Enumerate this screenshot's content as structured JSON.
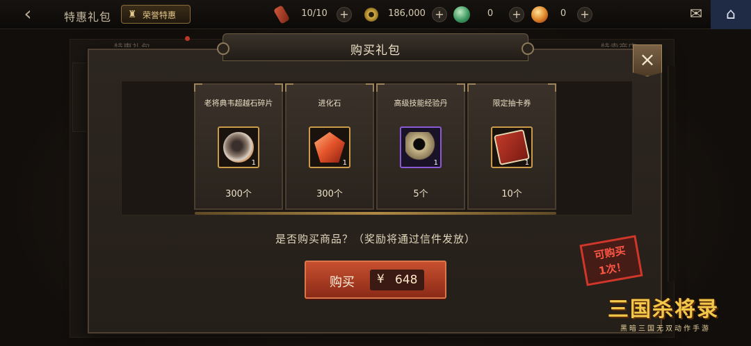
{
  "topbar": {
    "back_icon": "chevron-left-icon",
    "title": "特惠礼包",
    "honor_badge": "荣誉特惠",
    "resources": [
      {
        "name": "scroll",
        "value": "10/10",
        "color": "#b33a2a"
      },
      {
        "name": "copper-coin",
        "value": "186,000",
        "color": "#c9a34a"
      },
      {
        "name": "jade-orb",
        "value": "0",
        "color": "#3e9a62"
      },
      {
        "name": "gold-ingot",
        "value": "0",
        "color": "#d4782c"
      }
    ],
    "plus_glyph": "+",
    "chat_icon": "chat-bubble-icon",
    "home_icon": "home-icon"
  },
  "background": {
    "tab_left": "特惠礼包",
    "tab_right": "特卖商店"
  },
  "dialog": {
    "title": "购买礼包",
    "close_glyph": "×",
    "items": [
      {
        "name": "老将典韦超越石碎片",
        "qty": "300个",
        "count": "1",
        "icon": "dianwei-stone-fragment-icon",
        "rarity": "gold"
      },
      {
        "name": "进化石",
        "qty": "300个",
        "count": "1",
        "icon": "evolution-stone-icon",
        "rarity": "gold"
      },
      {
        "name": "高级技能经验丹",
        "qty": "5个",
        "count": "1",
        "icon": "skill-exp-pill-icon",
        "rarity": "purple"
      },
      {
        "name": "限定抽卡券",
        "qty": "10个",
        "count": "1",
        "icon": "gacha-ticket-icon",
        "rarity": "gold"
      }
    ],
    "confirm_text": "是否购买商品？（奖励将通过信件发放）",
    "buy_button": {
      "label": "购买",
      "currency": "¥",
      "price": "648"
    },
    "limit_stamp": {
      "line1": "可购买",
      "line2": "1次！"
    }
  },
  "logo": {
    "title": "三国杀将录",
    "subtitle": "黑暗三国无双动作手游"
  }
}
